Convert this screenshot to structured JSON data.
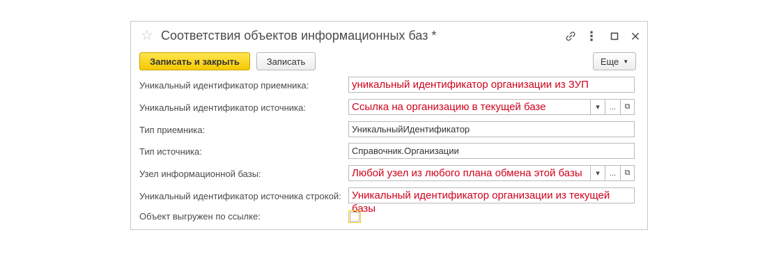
{
  "window": {
    "title": "Соответствия объектов информационных баз *"
  },
  "toolbar": {
    "save_close_label": "Записать и закрыть",
    "save_label": "Записать",
    "more_label": "Еще"
  },
  "form": {
    "fields": [
      {
        "label": "Уникальный идентификатор приемника:",
        "value": "уникальный идентификатор организации из ЗУП"
      },
      {
        "label": "Уникальный идентификатор источника:",
        "value": "Ссылка на организацию в текущей базе"
      },
      {
        "label": "Тип приемника:",
        "value": "УникальныйИдентификатор"
      },
      {
        "label": "Тип источника:",
        "value": "Справочник.Организации"
      },
      {
        "label": "Узел информационной базы:",
        "value": "Любой узел из любого плана обмена этой базы"
      },
      {
        "label": "Уникальный идентификатор источника строкой:",
        "value": "Уникальный идентификатор организации из текущей базы"
      },
      {
        "label": "Объект выгружен по ссылке:",
        "value": ""
      }
    ],
    "dropdown_symbol": "▾",
    "ellipsis_symbol": "...",
    "open_symbol": "⧉"
  },
  "icons": {
    "star": "☆",
    "more": "⋮"
  },
  "colors": {
    "accent": "#f5c900",
    "value_text": "#d0021b"
  }
}
